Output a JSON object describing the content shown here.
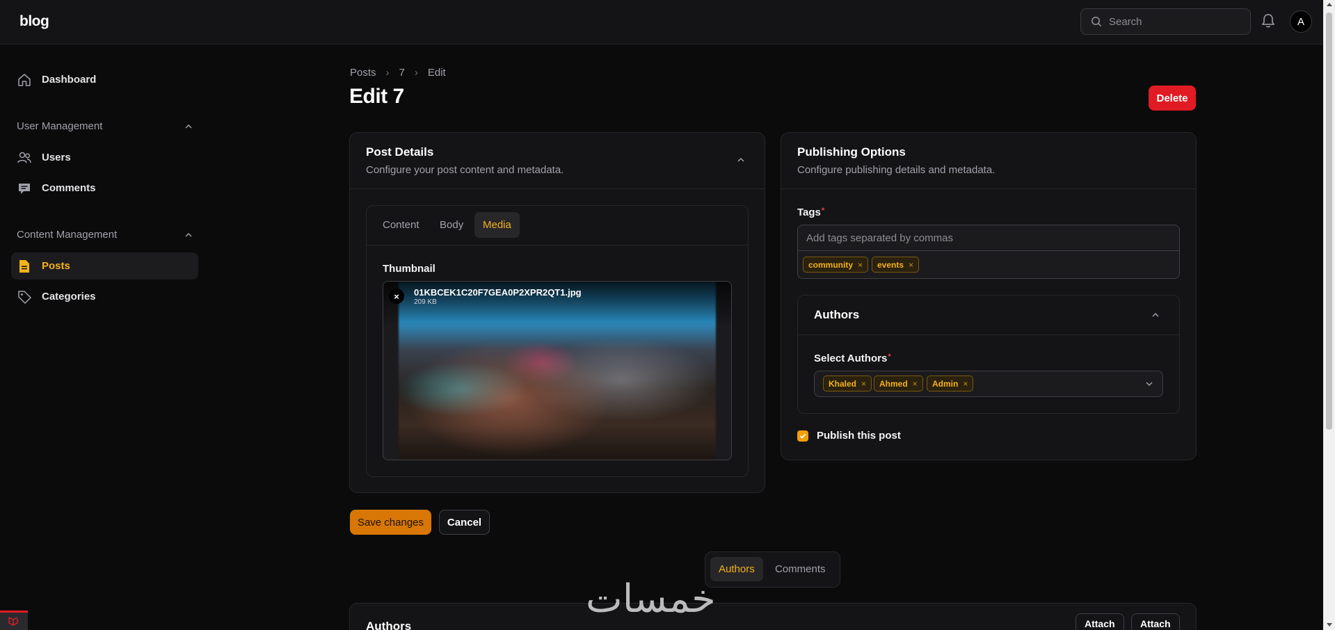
{
  "app": {
    "brand": "blog",
    "avatar_initial": "A"
  },
  "search": {
    "placeholder": "Search"
  },
  "sidebar": {
    "dashboard": "Dashboard",
    "group_user": "User Management",
    "users": "Users",
    "comments": "Comments",
    "group_content": "Content Management",
    "posts": "Posts",
    "categories": "Categories"
  },
  "breadcrumb": [
    "Posts",
    "7",
    "Edit"
  ],
  "page": {
    "title": "Edit 7",
    "delete_label": "Delete"
  },
  "post_details": {
    "title": "Post Details",
    "subtitle": "Configure your post content and metadata.",
    "tabs": [
      "Content",
      "Body",
      "Media"
    ],
    "active_tab": "Media",
    "thumbnail_label": "Thumbnail",
    "file_name": "01KBCEK1C20F7GEA0P2XPR2QT1.jpg",
    "file_size": "209 KB",
    "remove_symbol": "×"
  },
  "publishing": {
    "title": "Publishing Options",
    "subtitle": "Configure publishing details and metadata.",
    "tags_label": "Tags",
    "required_mark": "*",
    "tags_placeholder": "Add tags separated by commas",
    "tags": [
      "community",
      "events"
    ],
    "chip_remove": "×",
    "authors_title": "Authors",
    "select_authors_label": "Select Authors",
    "authors": [
      "Khaled",
      "Ahmed",
      "Admin"
    ],
    "publish_label": "Publish this post",
    "publish_checked": true
  },
  "actions": {
    "save": "Save changes",
    "cancel": "Cancel"
  },
  "relations": {
    "tabs": [
      "Authors",
      "Comments"
    ],
    "active": "Authors"
  },
  "bottom": {
    "title": "Authors",
    "attach1": "Attach",
    "attach2": "Attach"
  },
  "watermark": "خمسات",
  "colors": {
    "accent": "#f5b21b",
    "danger": "#e01b24",
    "save": "#d97706",
    "background": "#0b0b0c",
    "card": "#141416"
  }
}
